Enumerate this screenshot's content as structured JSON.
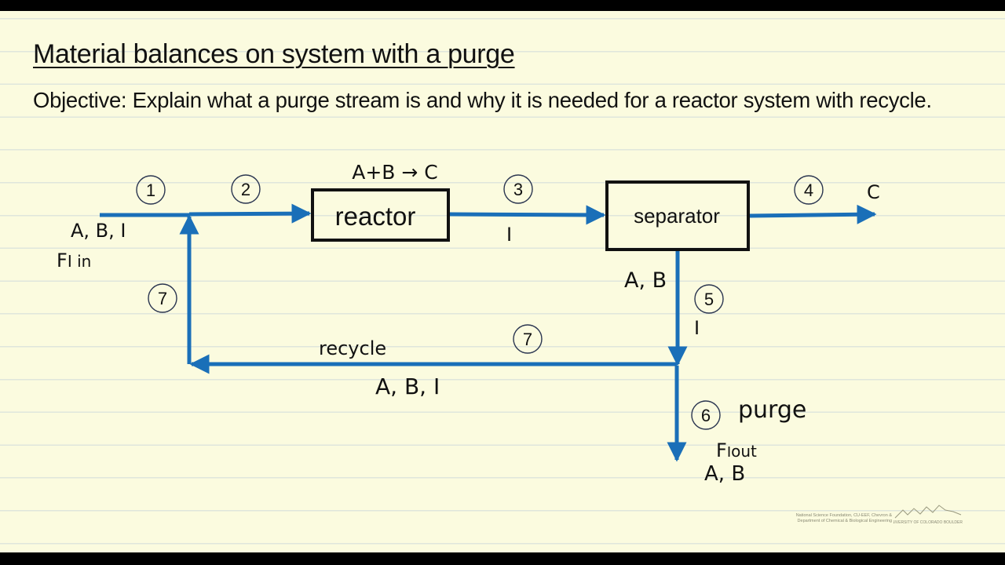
{
  "slide": {
    "title": "Material balances on system with a purge",
    "objective": "Objective:  Explain what a purge stream is and why it is needed for a reactor system with recycle."
  },
  "diagram": {
    "colors": {
      "stream": "#1a6fb8",
      "box": "#111111",
      "paper": "#fbfbdf",
      "circle": "#2a3550"
    },
    "units": {
      "reactor": {
        "label": "reactor",
        "reaction": "A+B → C"
      },
      "separator": {
        "label": "separator"
      }
    },
    "streams": [
      {
        "id": "1",
        "label": "1",
        "components": "A, B, I",
        "note": "F",
        "note_sub": "I",
        "note_suffix": " in"
      },
      {
        "id": "2",
        "label": "2"
      },
      {
        "id": "3",
        "label": "3",
        "components": "I"
      },
      {
        "id": "4",
        "label": "4",
        "components": "C"
      },
      {
        "id": "5",
        "label": "5",
        "components_top": "A, B",
        "components": "I"
      },
      {
        "id": "6",
        "label": "6",
        "name": "purge",
        "note": "F",
        "note_sub": "I",
        "note_suffix": "out",
        "components": "A, B"
      },
      {
        "id": "7a",
        "label": "7"
      },
      {
        "id": "7b",
        "label": "7",
        "name": "recycle",
        "components": "A, B, I"
      }
    ]
  },
  "footer": {
    "credit_line1": "National Science Foundation, CU-EEF, Chevron &",
    "credit_line2": "Department of Chemical & Biological Engineering",
    "university": "UNIVERSITY OF COLORADO BOULDER"
  }
}
